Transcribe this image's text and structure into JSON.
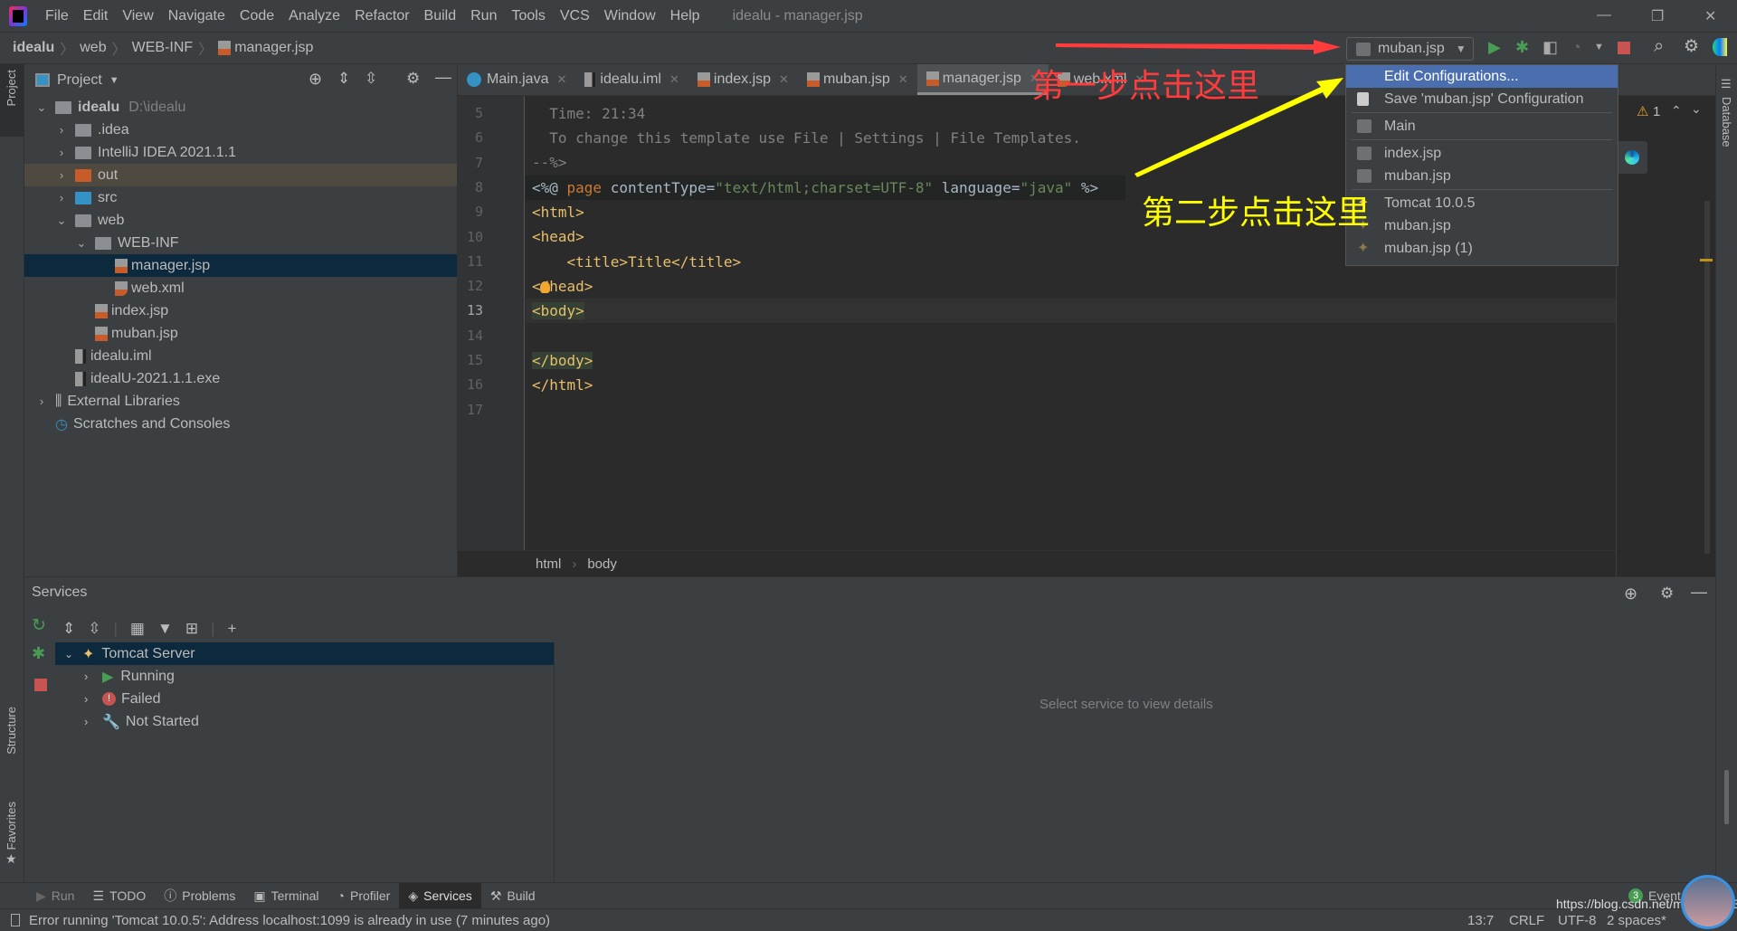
{
  "menubar": {
    "items": [
      "File",
      "Edit",
      "View",
      "Navigate",
      "Code",
      "Analyze",
      "Refactor",
      "Build",
      "Run",
      "Tools",
      "VCS",
      "Window",
      "Help"
    ],
    "window_title": "idealu - manager.jsp"
  },
  "breadcrumb": [
    "idealu",
    "web",
    "WEB-INF",
    "manager.jsp"
  ],
  "left_stripe": {
    "project": "Project",
    "structure": "Structure",
    "favorites": "Favorites"
  },
  "right_stripe": {
    "database": "Database"
  },
  "project": {
    "title": "Project",
    "tree": [
      {
        "label": "idealu",
        "hint": "D:\\idealu",
        "level": 0,
        "expanded": true,
        "icon": "module-icon"
      },
      {
        "label": ".idea",
        "level": 1,
        "expanded": false,
        "icon": "folder-icon"
      },
      {
        "label": "IntelliJ IDEA 2021.1.1",
        "level": 1,
        "expanded": false,
        "icon": "folder-icon"
      },
      {
        "label": "out",
        "level": 1,
        "expanded": false,
        "icon": "folder-orange-icon"
      },
      {
        "label": "src",
        "level": 1,
        "expanded": false,
        "icon": "folder-blue-icon"
      },
      {
        "label": "web",
        "level": 1,
        "expanded": true,
        "icon": "web-folder-icon"
      },
      {
        "label": "WEB-INF",
        "level": 2,
        "expanded": true,
        "icon": "folder-icon"
      },
      {
        "label": "manager.jsp",
        "level": 3,
        "icon": "jsp-file-icon",
        "selected": true
      },
      {
        "label": "web.xml",
        "level": 3,
        "icon": "xml-file-icon"
      },
      {
        "label": "index.jsp",
        "level": 2,
        "icon": "jsp-file-icon"
      },
      {
        "label": "muban.jsp",
        "level": 2,
        "icon": "jsp-file-icon"
      },
      {
        "label": "idealu.iml",
        "level": 1,
        "icon": "iml-file-icon"
      },
      {
        "label": "idealU-2021.1.1.exe",
        "level": 1,
        "icon": "unknown-file-icon"
      },
      {
        "label": "External Libraries",
        "level": 0,
        "expanded": false,
        "icon": "libraries-icon"
      },
      {
        "label": "Scratches and Consoles",
        "level": 0,
        "icon": "scratches-icon"
      }
    ]
  },
  "tabs": [
    {
      "label": "Main.java"
    },
    {
      "label": "idealu.iml"
    },
    {
      "label": "index.jsp"
    },
    {
      "label": "muban.jsp"
    },
    {
      "label": "manager.jsp",
      "active": true
    },
    {
      "label": "web.xml"
    }
  ],
  "editor": {
    "line_numbers": [
      "5",
      "6",
      "7",
      "8",
      "9",
      "10",
      "11",
      "12",
      "13",
      "14",
      "15",
      "16",
      "17"
    ],
    "l5": "  Time: 21:34",
    "l6": "  To change this template use File | Settings | File Templates.",
    "l7": "--%>",
    "l8a": "<%@ ",
    "l8b": "page",
    "l8c": " contentType=",
    "l8d": "\"text/html;charset=UTF-8\"",
    "l8e": " language=",
    "l8f": "\"java\"",
    "l8g": " %>",
    "l9": "<html>",
    "l10": "<head>",
    "l11": "    <title>Title</title>",
    "l12": "</head>",
    "l13": "<body>",
    "l15": "</body>",
    "l16": "</html>",
    "warnings": "1",
    "crumb": [
      "html",
      "body"
    ]
  },
  "run_config": {
    "selected": "muban.jsp"
  },
  "popup": {
    "items": [
      {
        "label": "Edit Configurations...",
        "selected": true
      },
      {
        "label": "Save 'muban.jsp' Configuration"
      },
      {
        "label": "Main"
      },
      {
        "label": "index.jsp"
      },
      {
        "label": "muban.jsp"
      },
      {
        "label": "Tomcat 10.0.5"
      },
      {
        "label": "muban.jsp"
      },
      {
        "label": "muban.jsp (1)"
      }
    ]
  },
  "annotations": {
    "step1": "第一步点击这里",
    "step2": "第二步点击这里",
    "step1_color": "#ff3b3b",
    "step2_color": "#ffff00"
  },
  "services": {
    "title": "Services",
    "tree": [
      {
        "label": "Tomcat Server"
      },
      {
        "label": "Running"
      },
      {
        "label": "Failed"
      },
      {
        "label": "Not Started"
      }
    ],
    "empty": "Select service to view details"
  },
  "bottom_tools": [
    "Run",
    "TODO",
    "Problems",
    "Terminal",
    "Profiler",
    "Services",
    "Build"
  ],
  "event_log": {
    "count": "3",
    "label": "Event Log"
  },
  "status": {
    "message": "Error running 'Tomcat 10.0.5': Address localhost:1099 is already in use (7 minutes ago)",
    "position": "13:7",
    "line_sep": "CRLF",
    "encoding": "UTF-8",
    "indent": "2 spaces*",
    "watermark": "https://blog.csdn.net/m0_46685329"
  }
}
